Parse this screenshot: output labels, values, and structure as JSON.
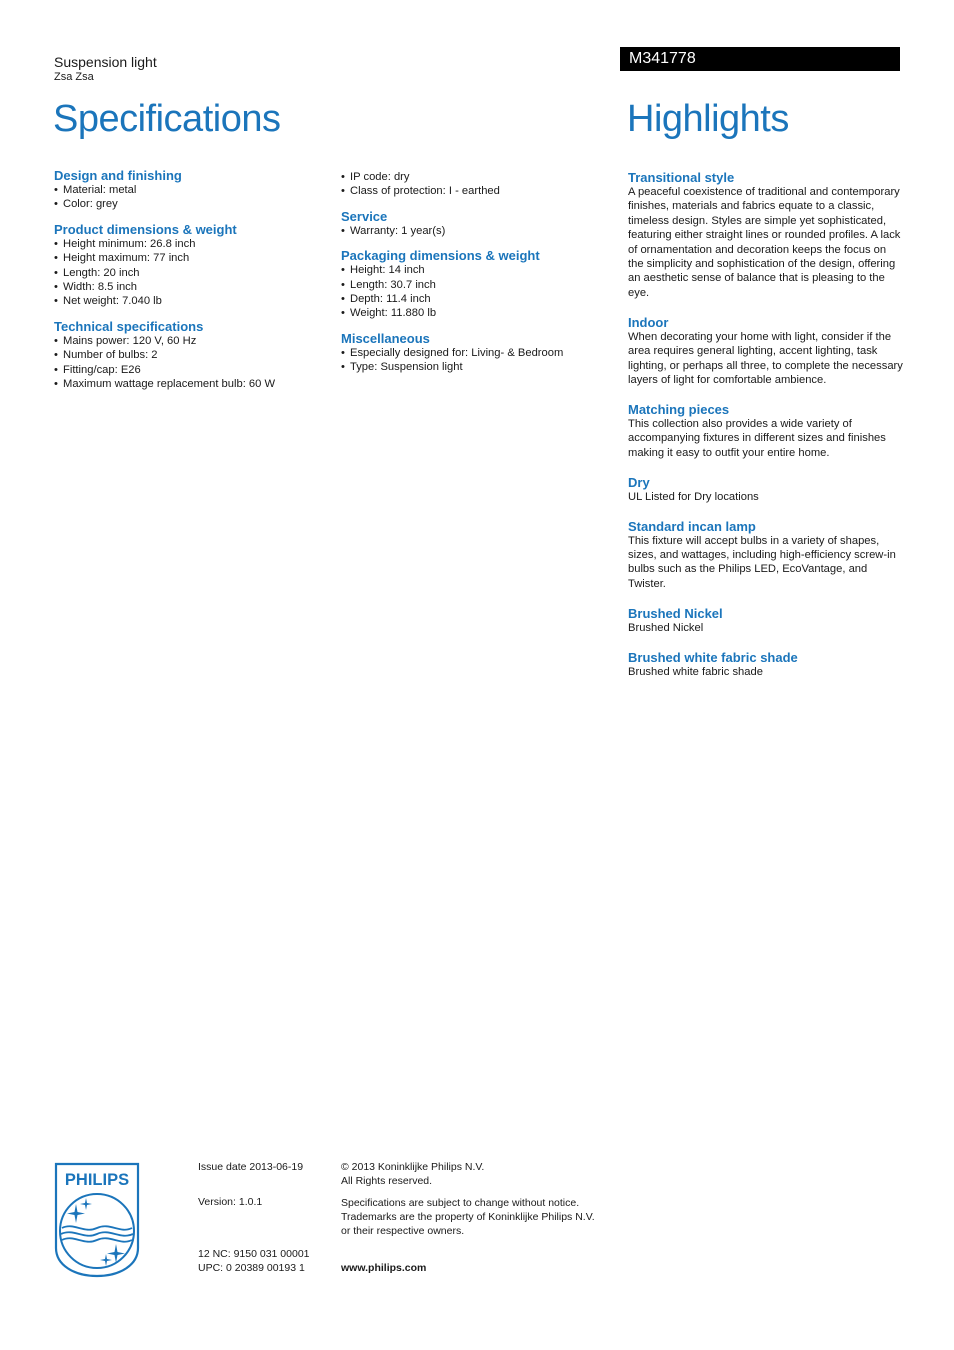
{
  "header": {
    "product_type": "Suspension light",
    "product_name": "Zsa Zsa",
    "model": "M341778",
    "specifications_title": "Specifications",
    "highlights_title": "Highlights"
  },
  "brand_color": "#1b75bb",
  "specifications": {
    "design": {
      "title": "Design and finishing",
      "items": [
        "Material: metal",
        "Color: grey"
      ]
    },
    "product_dimensions": {
      "title": "Product dimensions & weight",
      "items": [
        "Height minimum: 26.8 inch",
        "Height maximum: 77 inch",
        "Length: 20 inch",
        "Width: 8.5 inch",
        "Net weight: 7.040 lb"
      ]
    },
    "technical": {
      "title": "Technical specifications",
      "items": [
        "Mains power: 120 V, 60 Hz",
        "Number of bulbs: 2",
        "Fitting/cap: E26",
        "Maximum wattage replacement bulb: 60 W",
        "IP code: dry",
        "Class of protection: I - earthed"
      ]
    },
    "service": {
      "title": "Service",
      "items": [
        "Warranty: 1 year(s)"
      ]
    },
    "packaging": {
      "title": "Packaging dimensions & weight",
      "items": [
        "Height: 14 inch",
        "Length: 30.7 inch",
        "Depth: 11.4 inch",
        "Weight: 11.880 lb"
      ]
    },
    "misc": {
      "title": "Miscellaneous",
      "items": [
        "Especially designed for: Living- & Bedroom",
        "Type: Suspension light"
      ]
    }
  },
  "highlights": [
    {
      "title": "Transitional style",
      "text": "A peaceful coexistence of traditional and contemporary finishes, materials and fabrics equate to a classic, timeless design. Styles are simple yet sophisticated, featuring either straight lines or rounded profiles. A lack of ornamentation and decoration keeps the focus on the simplicity and sophistication of the design, offering an aesthetic sense of balance that is pleasing to the eye."
    },
    {
      "title": "Indoor",
      "text": "When decorating your home with light, consider if the area requires general lighting, accent lighting, task lighting, or perhaps all three, to complete the necessary layers of light for comfortable ambience."
    },
    {
      "title": "Matching pieces",
      "text": "This collection also provides a wide variety of accompanying fixtures in different sizes and finishes making it easy to outfit your entire home."
    },
    {
      "title": "Dry",
      "text": "UL Listed for Dry locations"
    },
    {
      "title": "Standard incan lamp",
      "text": "This fixture will accept bulbs in a variety of shapes, sizes, and wattages, including high-efficiency screw-in bulbs such as the Philips LED, EcoVantage, and Twister."
    },
    {
      "title": "Brushed Nickel",
      "text": "Brushed Nickel"
    },
    {
      "title": "Brushed white fabric shade",
      "text": "Brushed white fabric shade"
    }
  ],
  "footer": {
    "logo_text": "PHILIPS",
    "issue_date": "Issue date 2013-06-19",
    "version": "Version: 1.0.1",
    "nc": "12 NC: 9150 031 00001",
    "upc": "UPC: 0 20389 00193 1",
    "copyright_line1": "© 2013 Koninklijke Philips N.V.",
    "copyright_line2": "All Rights reserved.",
    "notice_line1": "Specifications are subject to change without notice.",
    "notice_line2": "Trademarks are the property of Koninklijke Philips N.V.",
    "notice_line3": "or their respective owners.",
    "website": "www.philips.com"
  }
}
